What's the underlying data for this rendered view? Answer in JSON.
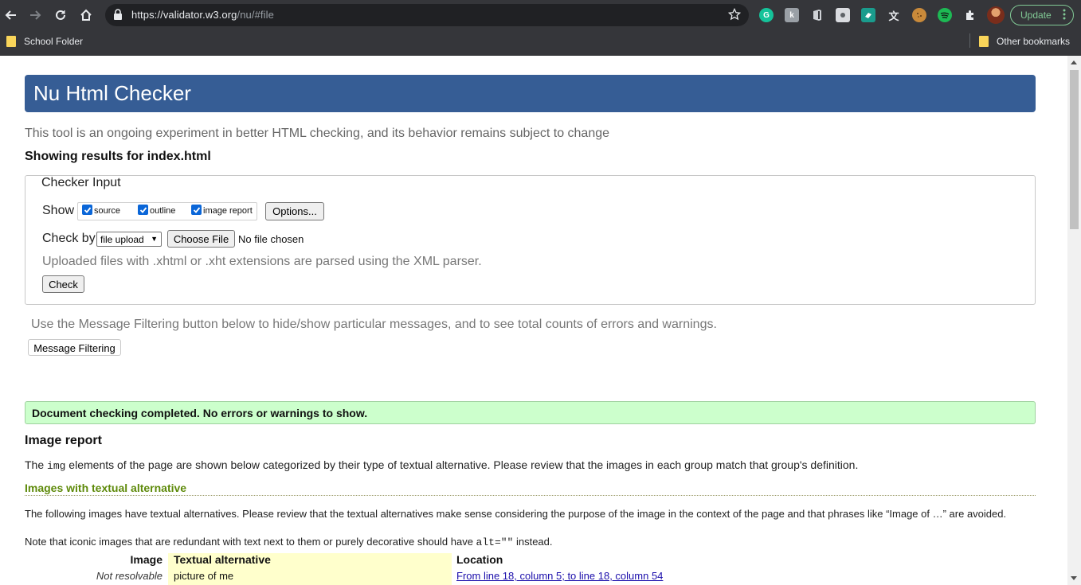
{
  "browser": {
    "url_host": "https://validator.w3.org",
    "url_path": "/nu/#file",
    "update_label": "Update",
    "bookmarks": {
      "school_folder": "School Folder",
      "other_bookmarks": "Other bookmarks"
    },
    "extension_icons": [
      "grammarly-icon",
      "k-extension-icon",
      "office-icon",
      "screenshot-icon",
      "rapid-icon",
      "language-icon",
      "cookie-icon",
      "spotify-icon",
      "puzzle-icon"
    ]
  },
  "page": {
    "title": "Nu Html Checker",
    "intro": "This tool is an ongoing experiment in better HTML checking, and its behavior remains subject to change",
    "results_for": "Showing results for index.html"
  },
  "checker_input": {
    "legend": "Checker Input",
    "show_label": "Show",
    "show_options": [
      {
        "label": "source",
        "checked": true
      },
      {
        "label": "outline",
        "checked": true
      },
      {
        "label": "image report",
        "checked": true
      }
    ],
    "options_button": "Options...",
    "check_by_label": "Check by",
    "check_by_value": "file upload",
    "choose_file_button": "Choose File",
    "no_file_text": "No file chosen",
    "parser_note": "Uploaded files with .xhtml or .xht extensions are parsed using the XML parser.",
    "check_button": "Check"
  },
  "filtering": {
    "note": "Use the Message Filtering button below to hide/show particular messages, and to see total counts of errors and warnings.",
    "button": "Message Filtering"
  },
  "status": {
    "message": "Document checking completed. No errors or warnings to show."
  },
  "image_report": {
    "title": "Image report",
    "desc_before": "The ",
    "desc_code": "img",
    "desc_after": " elements of the page are shown below categorized by their type of textual alternative. Please review that the images in each group match that group's definition.",
    "section_title": "Images with textual alternative",
    "section_desc": "The following images have textual alternatives. Please review that the textual alternatives make sense considering the purpose of the image in the context of the page and that phrases like “Image of …” are avoided.",
    "iconic_before": "Note that iconic images that are redundant with text next to them or purely decorative should have ",
    "iconic_code": "alt=\"\"",
    "iconic_after": " instead.",
    "table": {
      "headers": [
        "Image",
        "Textual alternative",
        "Location"
      ],
      "rows": [
        {
          "image": "Not resolvable",
          "alt": "picture of me",
          "location": "From line 18, column 5; to line 18, column 54"
        }
      ]
    }
  }
}
